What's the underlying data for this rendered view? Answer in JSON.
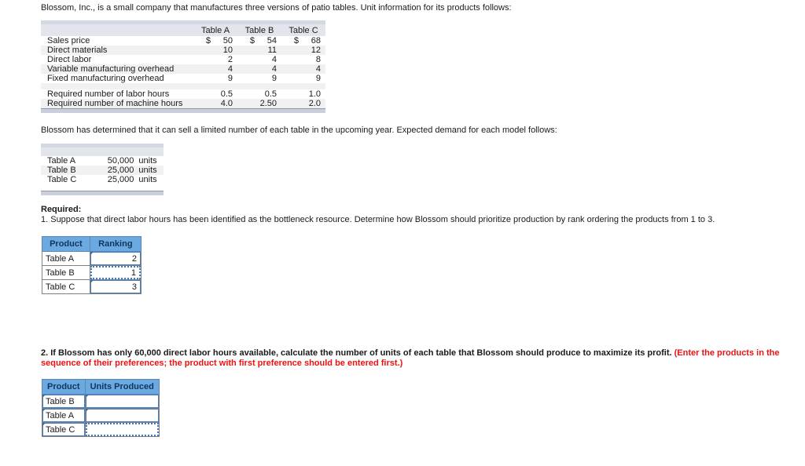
{
  "intro": {
    "paragraph1": "Blossom, Inc., is a small company that manufactures three versions of patio tables. Unit information for its products follows:",
    "paragraph2": "Blossom has determined that it can sell a limited number of each table in the upcoming year. Expected demand for each model follows:"
  },
  "unit_info_table": {
    "headers": [
      "",
      "Table A",
      "Table B",
      "Table C"
    ],
    "rows": [
      {
        "label": "Sales price",
        "a_cur": "$",
        "a": "50",
        "b_cur": "$",
        "b": "54",
        "c_cur": "$",
        "c": "68"
      },
      {
        "label": "Direct materials",
        "a_cur": "",
        "a": "10",
        "b_cur": "",
        "b": "11",
        "c_cur": "",
        "c": "12"
      },
      {
        "label": "Direct labor",
        "a_cur": "",
        "a": "2",
        "b_cur": "",
        "b": "4",
        "c_cur": "",
        "c": "8"
      },
      {
        "label": "Variable manufacturing overhead",
        "a_cur": "",
        "a": "4",
        "b_cur": "",
        "b": "4",
        "c_cur": "",
        "c": "4"
      },
      {
        "label": "Fixed manufacturing overhead",
        "a_cur": "",
        "a": "9",
        "b_cur": "",
        "b": "9",
        "c_cur": "",
        "c": "9"
      },
      {
        "label": "Required number of labor hours",
        "a_cur": "",
        "a": "0.5",
        "b_cur": "",
        "b": "0.5",
        "c_cur": "",
        "c": "1.0"
      },
      {
        "label": "Required number of machine hours",
        "a_cur": "",
        "a": "4.0",
        "b_cur": "",
        "b": "2.50",
        "c_cur": "",
        "c": "2.0"
      }
    ]
  },
  "demand_table": {
    "rows": [
      {
        "label": "Table A",
        "value": "50,000",
        "unit": "units"
      },
      {
        "label": "Table B",
        "value": "25,000",
        "unit": "units"
      },
      {
        "label": "Table C",
        "value": "25,000",
        "unit": "units"
      }
    ]
  },
  "required": {
    "heading": "Required:",
    "q1": "1. Suppose that direct labor hours has been identified as the bottleneck resource. Determine how Blossom should prioritize production by rank ordering the products from 1 to 3.",
    "q2_black": "2. If Blossom has only 60,000 direct labor hours available, calculate the number of units of each table that Blossom should produce to maximize its profit. ",
    "q2_red": "(Enter the products in the sequence of their preferences; the product with first preference should be entered first.)"
  },
  "ranking_table": {
    "headers": [
      "Product",
      "Ranking"
    ],
    "rows": [
      {
        "product": "Table A",
        "ranking": "2"
      },
      {
        "product": "Table B",
        "ranking": "1"
      },
      {
        "product": "Table C",
        "ranking": "3"
      }
    ]
  },
  "units_produced_table": {
    "headers": [
      "Product",
      "Units Produced"
    ],
    "rows": [
      {
        "product": "Table B",
        "units": ""
      },
      {
        "product": "Table A",
        "units": ""
      },
      {
        "product": "Table C",
        "units": ""
      }
    ]
  }
}
